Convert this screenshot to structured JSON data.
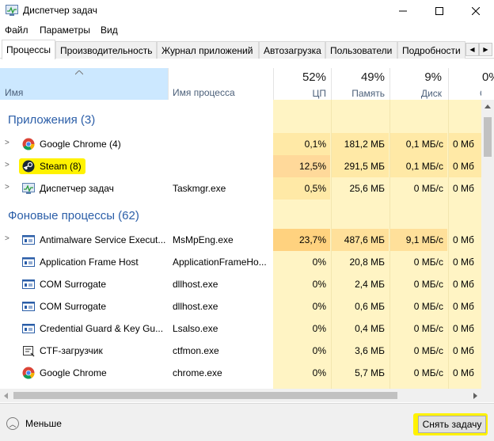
{
  "window": {
    "title": "Диспетчер задач"
  },
  "menu": [
    "Файл",
    "Параметры",
    "Вид"
  ],
  "tabs": [
    "Процессы",
    "Производительность",
    "Журнал приложений",
    "Автозагрузка",
    "Пользователи",
    "Подробности"
  ],
  "columns": {
    "name": "Имя",
    "process": "Имя процесса",
    "cpu": {
      "pct": "52%",
      "label": "ЦП"
    },
    "memory": {
      "pct": "49%",
      "label": "Память"
    },
    "disk": {
      "pct": "9%",
      "label": "Диск"
    },
    "network": {
      "pct": "0%",
      "label": "Сеть"
    }
  },
  "groups": {
    "apps": "Приложения (3)",
    "background": "Фоновые процессы (62)"
  },
  "rows": [
    {
      "name": "Google Chrome (4)",
      "process": "",
      "cpu": "0,1%",
      "mem": "181,2 МБ",
      "disk": "0,1 МБ/с",
      "net": "0 Мб",
      "icon": "chrome-icon"
    },
    {
      "name": "Steam (8)",
      "process": "",
      "cpu": "12,5%",
      "mem": "291,5 МБ",
      "disk": "0,1 МБ/с",
      "net": "0 Мб",
      "icon": "steam-icon"
    },
    {
      "name": "Диспетчер задач",
      "process": "Taskmgr.exe",
      "cpu": "0,5%",
      "mem": "25,6 МБ",
      "disk": "0 МБ/с",
      "net": "0 Мб",
      "icon": "taskmgr-icon"
    },
    {
      "name": "Antimalware Service Execut...",
      "process": "MsMpEng.exe",
      "cpu": "23,7%",
      "mem": "487,6 МБ",
      "disk": "9,1 МБ/с",
      "net": "0 Мб",
      "icon": "service-icon"
    },
    {
      "name": "Application Frame Host",
      "process": "ApplicationFrameHo...",
      "cpu": "0%",
      "mem": "20,8 МБ",
      "disk": "0 МБ/с",
      "net": "0 Мб",
      "icon": "service-icon"
    },
    {
      "name": "COM Surrogate",
      "process": "dllhost.exe",
      "cpu": "0%",
      "mem": "2,4 МБ",
      "disk": "0 МБ/с",
      "net": "0 Мб",
      "icon": "service-icon"
    },
    {
      "name": "COM Surrogate",
      "process": "dllhost.exe",
      "cpu": "0%",
      "mem": "0,6 МБ",
      "disk": "0 МБ/с",
      "net": "0 Мб",
      "icon": "service-icon"
    },
    {
      "name": "Credential Guard & Key Gu...",
      "process": "Lsalso.exe",
      "cpu": "0%",
      "mem": "0,4 МБ",
      "disk": "0 МБ/с",
      "net": "0 Мб",
      "icon": "service-icon"
    },
    {
      "name": "CTF-загрузчик",
      "process": "ctfmon.exe",
      "cpu": "0%",
      "mem": "3,6 МБ",
      "disk": "0 МБ/с",
      "net": "0 Мб",
      "icon": "ctf-icon"
    },
    {
      "name": "Google Chrome",
      "process": "chrome.exe",
      "cpu": "0%",
      "mem": "5,7 МБ",
      "disk": "0 МБ/с",
      "net": "0 Мб",
      "icon": "chrome-icon"
    }
  ],
  "footer": {
    "less": "Меньше",
    "end_task": "Снять задачу"
  },
  "colors": {
    "usage_light": "#fff4c4",
    "usage_mid": "#ffe9a6",
    "usage_high": "#ffd27f",
    "highlight": "#fff200",
    "group": "#2b5ea8"
  }
}
